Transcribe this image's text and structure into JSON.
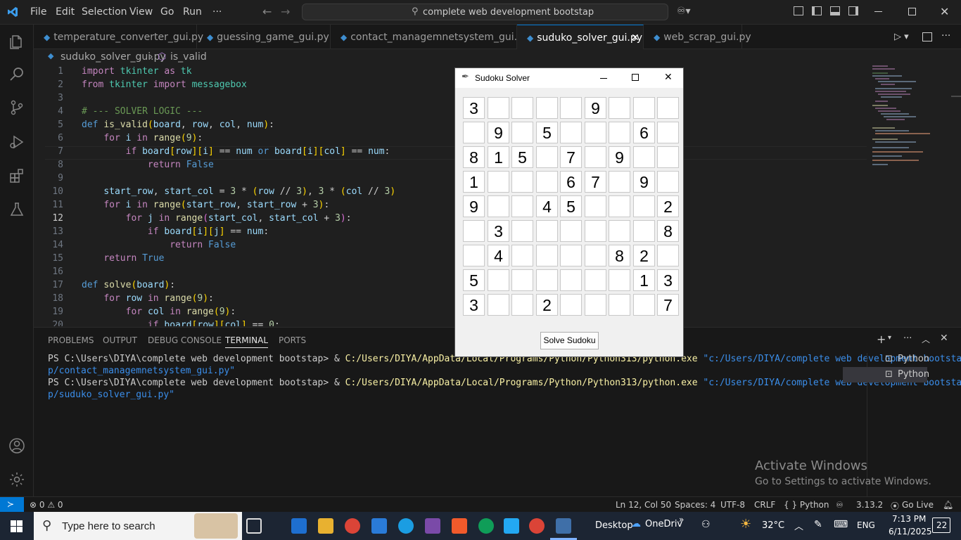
{
  "menu": [
    "File",
    "Edit",
    "Selection",
    "View",
    "Go",
    "Run",
    "···"
  ],
  "search": "complete web development bootstap",
  "tabs": [
    {
      "label": "temperature_converter_gui.py"
    },
    {
      "label": "guessing_game_gui.py"
    },
    {
      "label": "contact_managemnetsystem_gui.py"
    },
    {
      "label": "suduko_solver_gui.py",
      "close": "✕"
    },
    {
      "label": "web_scrap_gui.py"
    }
  ],
  "breadcrumb": {
    "file": "suduko_solver_gui.py",
    "sep": "›",
    "symbol": "is_valid"
  },
  "editor": {
    "line_numbers": [
      "1",
      "2",
      "3",
      "4",
      "5",
      "6",
      "7",
      "8",
      "9",
      "10",
      "11",
      "12",
      "13",
      "14",
      "15",
      "16",
      "17",
      "18",
      "19",
      "20"
    ],
    "current_line": "12"
  },
  "panel": {
    "tabs": [
      "PROBLEMS",
      "OUTPUT",
      "DEBUG CONSOLE",
      "TERMINAL",
      "PORTS"
    ],
    "active_tab": "TERMINAL",
    "terminal": [
      {
        "prompt": "PS C:\\Users\\DIYA\\complete web development bootstap> & ",
        "exe": "C:/Users/DIYA/AppData/Local/Programs/Python/Python313/python.exe",
        "arg": " \"c:/Users/DIYA/complete web development bootsta",
        "wrap": "p/contact_managemnetsystem_gui.py\""
      },
      {
        "prompt": "PS C:\\Users\\DIYA\\complete web development bootstap> & ",
        "exe": "C:/Users/DIYA/AppData/Local/Programs/Python/Python313/python.exe",
        "arg": " \"c:/Users/DIYA/complete web development bootsta",
        "wrap": "p/suduko_solver_gui.py\""
      }
    ],
    "terminal_list": [
      "Python",
      "Python"
    ]
  },
  "watermark": {
    "title": "Activate Windows",
    "subtitle": "Go to Settings to activate Windows."
  },
  "statusbar": {
    "problems": "⊗ 0 ⚠ 0",
    "position": "Ln 12, Col 50",
    "spaces": "Spaces: 4",
    "encoding": "UTF-8",
    "eol": "CRLF",
    "language": "{ } Python",
    "version": "3.13.2",
    "golive": "Go Live"
  },
  "sudoku_window": {
    "title": "Sudoku Solver",
    "board": [
      [
        "3",
        "",
        "",
        "",
        "",
        "9",
        "",
        "",
        ""
      ],
      [
        "",
        "9",
        "",
        "5",
        "",
        "",
        "",
        "6",
        ""
      ],
      [
        "8",
        "1",
        "5",
        "",
        "7",
        "",
        "9",
        "",
        ""
      ],
      [
        "1",
        "",
        "",
        "",
        "6",
        "7",
        "",
        "9",
        ""
      ],
      [
        "9",
        "",
        "",
        "4",
        "5",
        "",
        "",
        "",
        "2"
      ],
      [
        "",
        "3",
        "",
        "",
        "",
        "",
        "",
        "",
        "8"
      ],
      [
        "",
        "4",
        "",
        "",
        "",
        "",
        "8",
        "2",
        ""
      ],
      [
        "5",
        "",
        "",
        "",
        "",
        "",
        "",
        "1",
        "3"
      ],
      [
        "3",
        "",
        "",
        "2",
        "",
        "",
        "",
        "",
        "7"
      ]
    ],
    "button": "Solve Sudoku"
  },
  "taskbar": {
    "search_placeholder": "Type here to search",
    "desktop": "Desktop",
    "onedrive": "OneDriv",
    "weather": "32°C",
    "lang": "ENG",
    "time": "7:13 PM",
    "date": "6/11/2025",
    "notifications": "22"
  }
}
